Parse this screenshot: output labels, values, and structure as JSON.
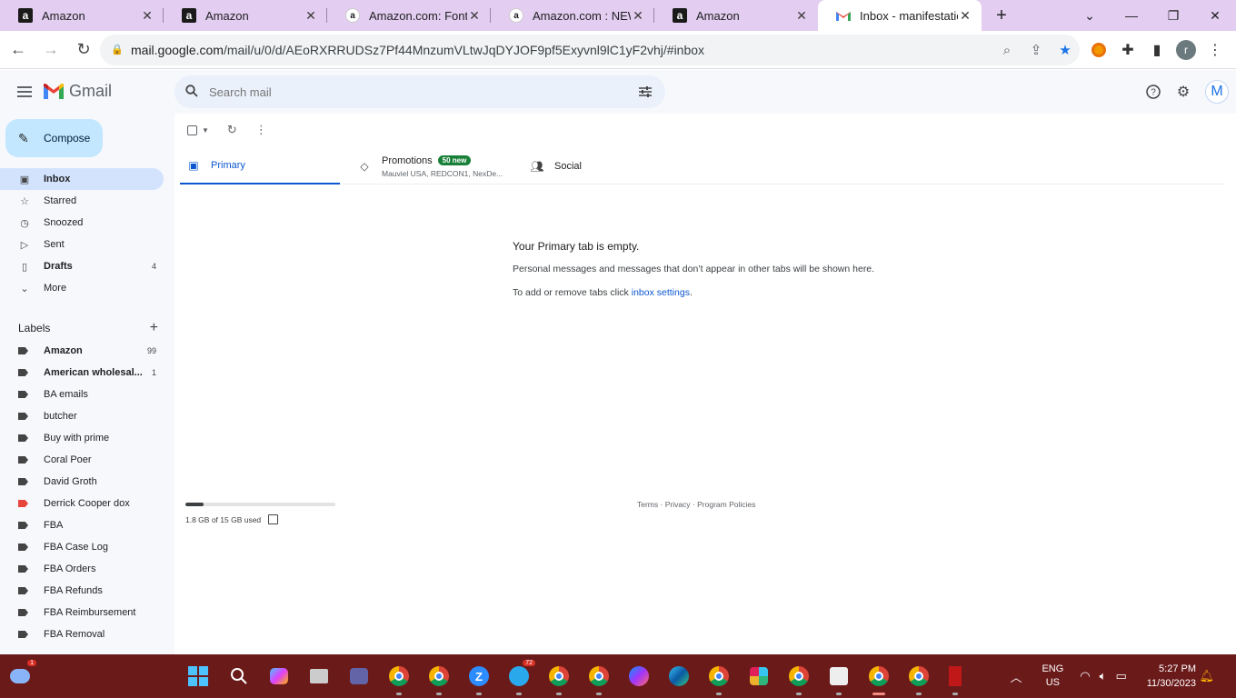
{
  "browser": {
    "tabs": [
      {
        "title": "Amazon",
        "favicon": "amazon"
      },
      {
        "title": "Amazon",
        "favicon": "amazon"
      },
      {
        "title": "Amazon.com: Fontan",
        "favicon": "amazon-smile"
      },
      {
        "title": "Amazon.com : NEWM",
        "favicon": "amazon-smile"
      },
      {
        "title": "Amazon",
        "favicon": "amazon"
      },
      {
        "title": "Inbox - manifestation",
        "favicon": "gmail",
        "active": true
      }
    ],
    "url_host": "mail.google.com",
    "url_path": "/mail/u/0/d/AEoRXRRUDSz7Pf44MnzumVLtwJqDYJOF9pf5Exyvnl9lC1yF2vhj/#inbox",
    "profile_initial": "r"
  },
  "gmail": {
    "app_name": "Gmail",
    "search_placeholder": "Search mail",
    "account_initial": "M",
    "compose_label": "Compose",
    "nav": [
      {
        "label": "Inbox",
        "icon": "inbox-icon",
        "active": true
      },
      {
        "label": "Starred",
        "icon": "star-icon"
      },
      {
        "label": "Snoozed",
        "icon": "clock-icon"
      },
      {
        "label": "Sent",
        "icon": "send-icon"
      },
      {
        "label": "Drafts",
        "icon": "draft-icon",
        "count": "4",
        "bold": true
      },
      {
        "label": "More",
        "icon": "chevron-down-icon"
      }
    ],
    "labels_heading": "Labels",
    "labels": [
      {
        "label": "Amazon",
        "count": "99",
        "bold": true,
        "color": "#444444"
      },
      {
        "label": "American wholesal...",
        "count": "1",
        "bold": true,
        "color": "#444444"
      },
      {
        "label": "BA emails",
        "color": "#444444"
      },
      {
        "label": "butcher",
        "color": "#444444"
      },
      {
        "label": "Buy with prime",
        "color": "#444444"
      },
      {
        "label": "Coral Poer",
        "color": "#444444"
      },
      {
        "label": "David Groth",
        "color": "#444444"
      },
      {
        "label": "Derrick Cooper dox",
        "color": "#e8453c"
      },
      {
        "label": "FBA",
        "color": "#444444"
      },
      {
        "label": "FBA Case Log",
        "color": "#444444"
      },
      {
        "label": "FBA Orders",
        "color": "#444444"
      },
      {
        "label": "FBA Refunds",
        "color": "#444444"
      },
      {
        "label": "FBA Reimbursement",
        "color": "#444444"
      },
      {
        "label": "FBA Removal",
        "color": "#444444"
      }
    ],
    "tabs": {
      "primary": "Primary",
      "promotions": "Promotions",
      "promotions_badge": "50 new",
      "promotions_senders": "Mauviel USA, REDCON1, NexDe...",
      "social": "Social"
    },
    "empty": {
      "heading": "Your Primary tab is empty.",
      "line1": "Personal messages and messages that don’t appear in other tabs will be shown here.",
      "line2_prefix": "To add or remove tabs click ",
      "line2_link": "inbox settings",
      "line2_suffix": "."
    },
    "storage": {
      "text": "1.8 GB of 15 GB used",
      "used_fraction": 0.12
    },
    "footer": "Terms · Privacy · Program Policies"
  },
  "taskbar": {
    "lang_line1": "ENG",
    "lang_line2": "US",
    "time": "5:27 PM",
    "date": "11/30/2023",
    "badges": {
      "weather": "1",
      "telegram": "72"
    }
  }
}
